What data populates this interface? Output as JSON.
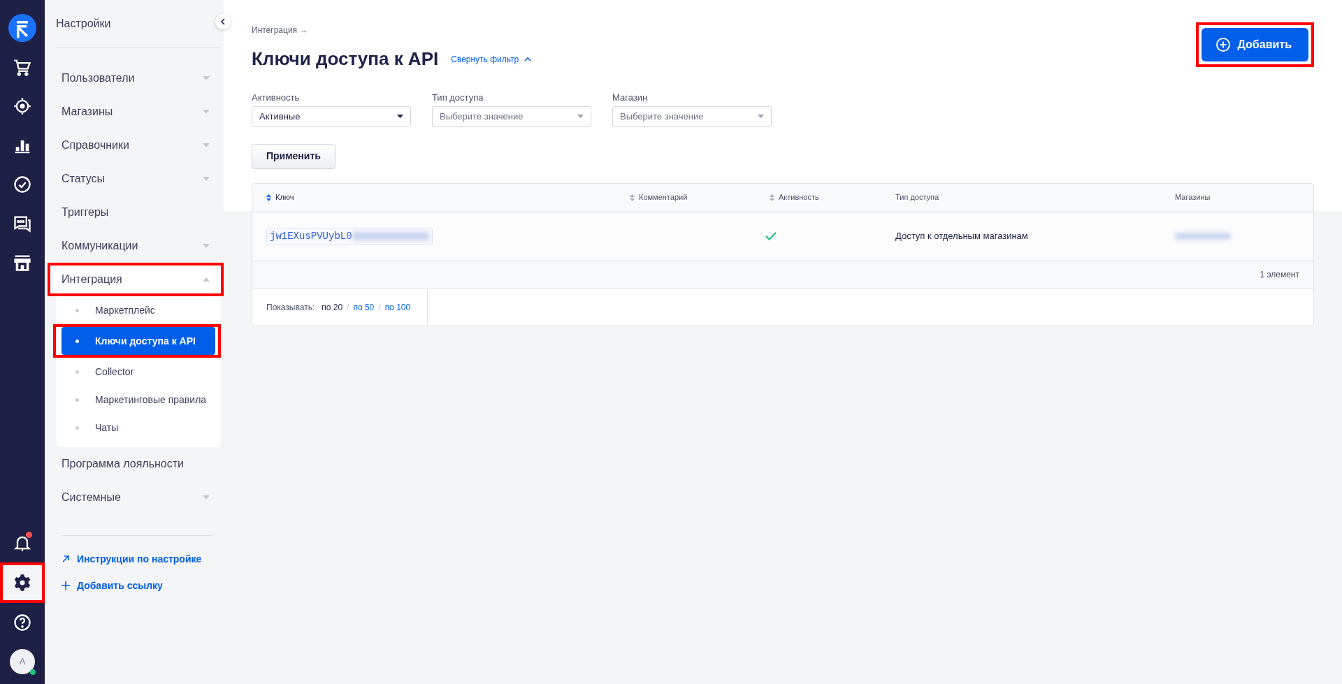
{
  "rail": {
    "top": [
      {
        "kind": "logo",
        "selected": false,
        "highlighted": false
      },
      {
        "kind": "cart",
        "selected": false,
        "highlighted": false
      },
      {
        "kind": "target",
        "selected": false,
        "highlighted": false
      },
      {
        "kind": "chart",
        "selected": false,
        "highlighted": false
      },
      {
        "kind": "check",
        "selected": false,
        "highlighted": false
      },
      {
        "kind": "chat",
        "selected": false,
        "highlighted": false
      },
      {
        "kind": "store",
        "selected": false,
        "highlighted": false
      }
    ],
    "bottom": [
      {
        "kind": "bell",
        "selected": false,
        "highlighted": false,
        "unread": true
      },
      {
        "kind": "gear",
        "selected": true,
        "highlighted": true,
        "unread": false
      },
      {
        "kind": "help",
        "selected": false,
        "highlighted": false,
        "unread": false
      }
    ],
    "avatar": {
      "initial": "A",
      "online": true
    }
  },
  "sidebar": {
    "title": "Настройки",
    "items": [
      {
        "label": "Пользователи",
        "expandable": true,
        "expanded": false,
        "highlighted": false
      },
      {
        "label": "Магазины",
        "expandable": true,
        "expanded": false,
        "highlighted": false
      },
      {
        "label": "Справочники",
        "expandable": true,
        "expanded": false,
        "highlighted": false
      },
      {
        "label": "Статусы",
        "expandable": true,
        "expanded": false,
        "highlighted": false
      },
      {
        "label": "Триггеры",
        "expandable": false,
        "highlighted": false
      },
      {
        "label": "Коммуникации",
        "expandable": true,
        "expanded": false,
        "highlighted": false
      },
      {
        "label": "Интеграция",
        "expandable": true,
        "expanded": true,
        "highlighted": true,
        "children": [
          {
            "label": "Маркетплейс",
            "selected": false,
            "highlighted": false
          },
          {
            "label": "Ключи доступа к API",
            "selected": true,
            "highlighted": true
          },
          {
            "label": "Collector",
            "selected": false,
            "highlighted": false
          },
          {
            "label": "Маркетинговые правила",
            "selected": false,
            "highlighted": false
          },
          {
            "label": "Чаты",
            "selected": false,
            "highlighted": false
          }
        ]
      },
      {
        "label": "Программа лояльности",
        "expandable": false,
        "highlighted": false
      },
      {
        "label": "Системные",
        "expandable": true,
        "expanded": false,
        "highlighted": false
      }
    ],
    "links": [
      {
        "kind": "external",
        "label": "Инструкции по настройке"
      },
      {
        "kind": "add",
        "label": "Добавить ссылку"
      }
    ]
  },
  "header": {
    "breadcrumb": "Интеграция →",
    "title": "Ключи доступа к API",
    "filter_toggle": {
      "label": "Свернуть фильтр",
      "expanded": true
    },
    "add_button": {
      "label": "Добавить",
      "highlighted": true
    }
  },
  "filters": [
    {
      "label": "Активность",
      "value": "Активные"
    },
    {
      "label": "Тип доступа",
      "placeholder": "Выберите значение"
    },
    {
      "label": "Магазин",
      "placeholder": "Выберите значение"
    }
  ],
  "apply_button": "Применить",
  "table": {
    "columns": [
      {
        "label": "Ключ",
        "sortable": true,
        "sort_active": true
      },
      {
        "label": "Комментарий",
        "sortable": true,
        "sort_active": false
      },
      {
        "label": "Активность",
        "sortable": true,
        "sort_active": false
      },
      {
        "label": "Тип доступа",
        "sortable": false,
        "sort_active": false
      },
      {
        "label": "Магазины",
        "sortable": false,
        "sort_active": false
      }
    ],
    "rows": [
      {
        "key": "jw1EXusPVUybL0",
        "key_redacted": true,
        "active": true,
        "access_type": "Доступ к отдельным магазинам",
        "stores_redacted": true
      }
    ],
    "summary": "1 элемент",
    "page_size": {
      "label": "Показывать:",
      "separator": "/",
      "options": [
        {
          "label": "по 20",
          "selected": true
        },
        {
          "label": "по 50",
          "selected": false
        },
        {
          "label": "по 100",
          "selected": false
        }
      ]
    }
  }
}
